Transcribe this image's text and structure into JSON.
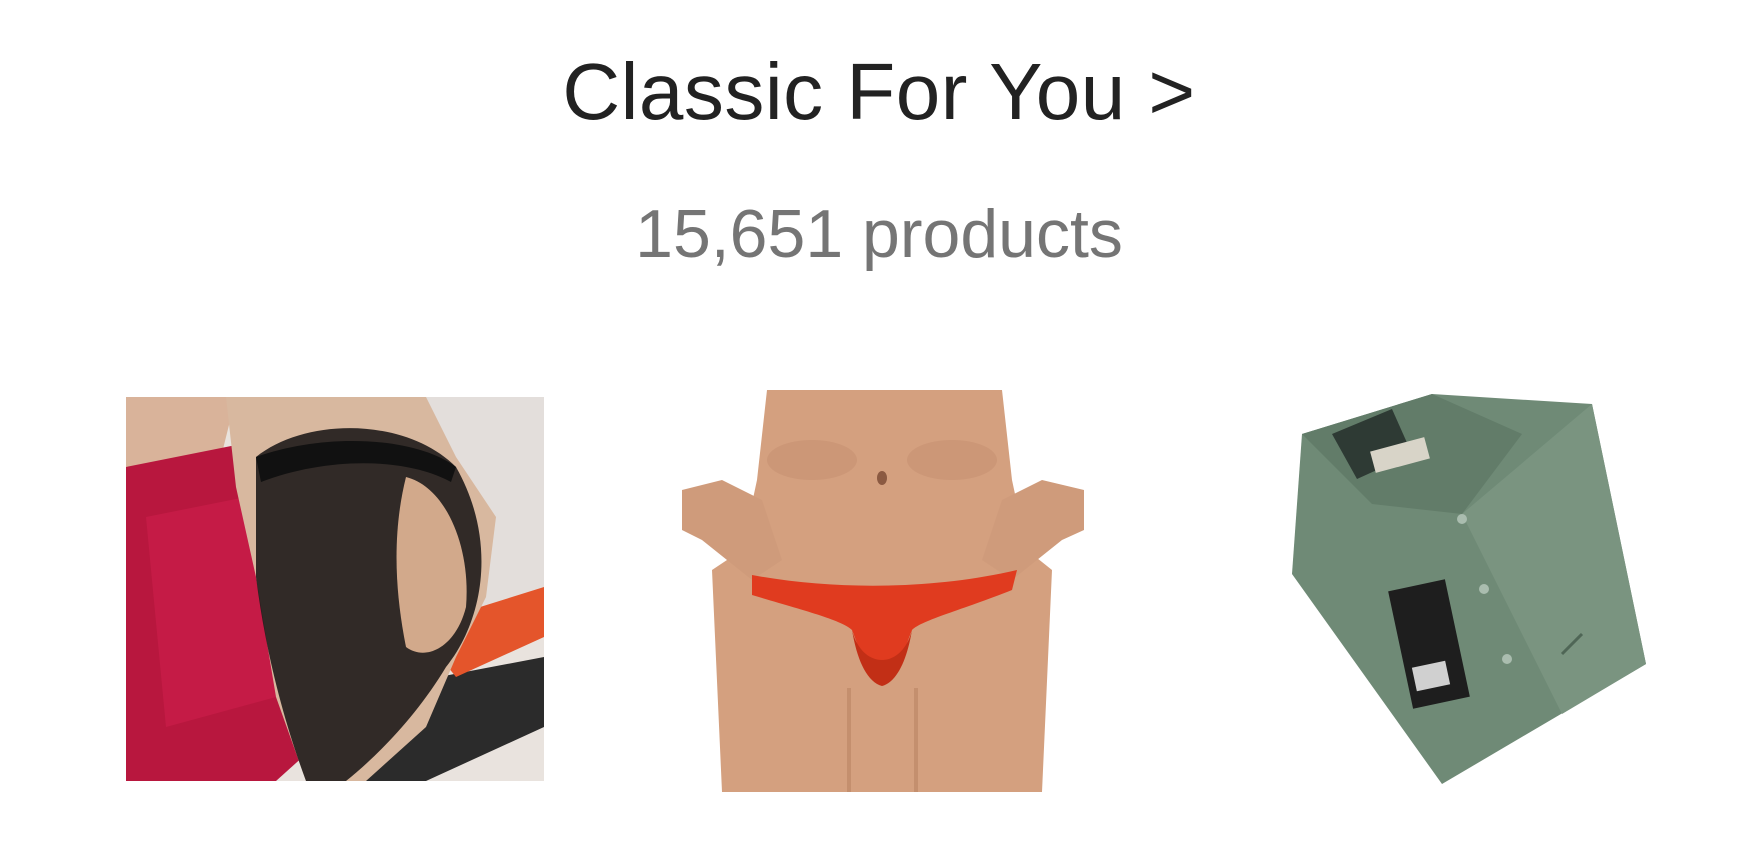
{
  "section": {
    "title": "Classic For You >",
    "product_count": "15,651 products"
  },
  "products": [
    {
      "icon": "tights-product-image"
    },
    {
      "icon": "briefs-product-image"
    },
    {
      "icon": "shirt-product-image"
    }
  ],
  "colors": {
    "title": "#222222",
    "subtitle": "#757575",
    "background": "#ffffff"
  }
}
